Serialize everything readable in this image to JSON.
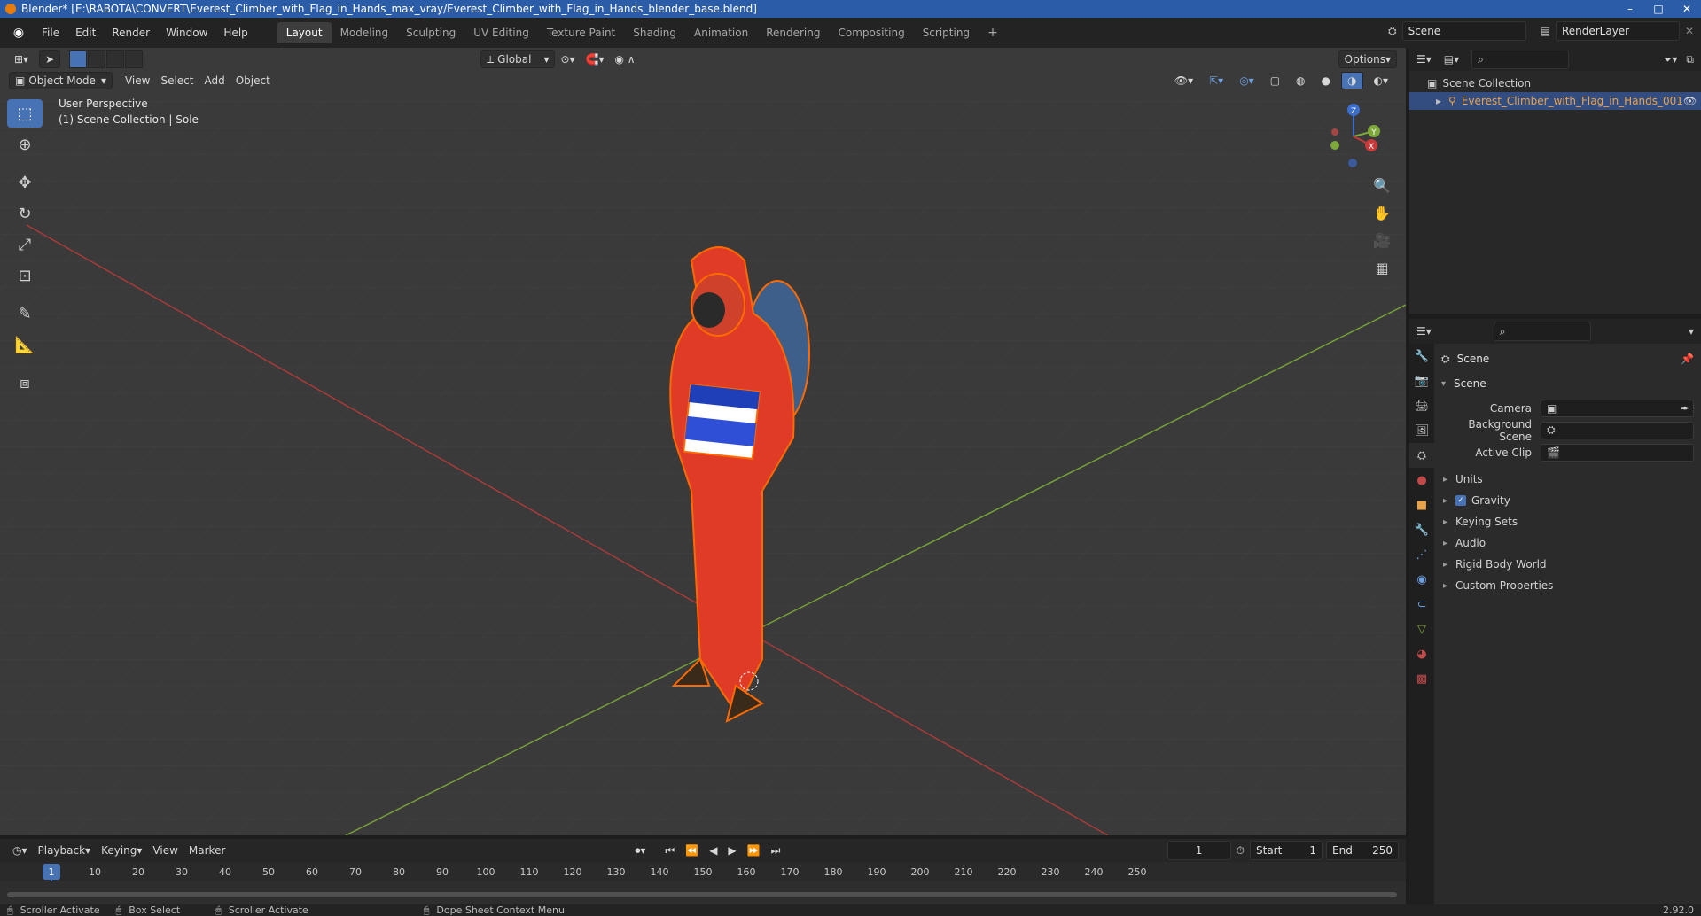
{
  "window": {
    "title": "Blender* [E:\\RABOTA\\CONVERT\\Everest_Climber_with_Flag_in_Hands_max_vray/Everest_Climber_with_Flag_in_Hands_blender_base.blend]",
    "controls": [
      "–",
      "□",
      "✕"
    ]
  },
  "menubar": {
    "items": [
      "File",
      "Edit",
      "Render",
      "Window",
      "Help"
    ],
    "workspaces": [
      "Layout",
      "Modeling",
      "Sculpting",
      "UV Editing",
      "Texture Paint",
      "Shading",
      "Animation",
      "Rendering",
      "Compositing",
      "Scripting"
    ],
    "active_workspace": "Layout",
    "add_tab": "+",
    "scene_name": "Scene",
    "render_layer": "RenderLayer"
  },
  "viewport": {
    "mode": "Object Mode",
    "menus": [
      "View",
      "Select",
      "Add",
      "Object"
    ],
    "transform_orientation": "Global",
    "options_label": "Options",
    "perspective_label": "User Perspective",
    "collection_label": "(1) Scene Collection | Sole",
    "axes": {
      "x": "X",
      "y": "Y",
      "z": "Z"
    }
  },
  "outliner": {
    "root": "Scene Collection",
    "object": "Everest_Climber_with_Flag_in_Hands_001"
  },
  "properties": {
    "title": "Scene",
    "panel": "Scene",
    "rows": [
      {
        "label": "Camera",
        "value": ""
      },
      {
        "label": "Background Scene",
        "value": ""
      },
      {
        "label": "Active Clip",
        "value": ""
      }
    ],
    "subpanels": [
      "Units",
      "Gravity",
      "Keying Sets",
      "Audio",
      "Rigid Body World",
      "Custom Properties"
    ],
    "gravity_checked": true
  },
  "timeline": {
    "menus": [
      "Playback",
      "Keying",
      "View",
      "Marker"
    ],
    "current_frame": "1",
    "start_label": "Start",
    "start": "1",
    "end_label": "End",
    "end": "250",
    "ticks": [
      "1",
      "10",
      "20",
      "30",
      "40",
      "50",
      "60",
      "70",
      "80",
      "90",
      "100",
      "110",
      "120",
      "130",
      "140",
      "150",
      "160",
      "170",
      "180",
      "190",
      "200",
      "210",
      "220",
      "230",
      "240",
      "250"
    ]
  },
  "statusbar": {
    "items": [
      "Scroller Activate",
      "Box Select",
      "Scroller Activate",
      "Dope Sheet Context Menu"
    ],
    "version": "2.92.0"
  },
  "colors": {
    "accent": "#4772b3",
    "selection_outline": "#ff6a00",
    "suit": "#e03b26",
    "backpack": "#3d5f8a",
    "x_axis": "#c83a3a",
    "y_axis": "#7ea93a"
  }
}
